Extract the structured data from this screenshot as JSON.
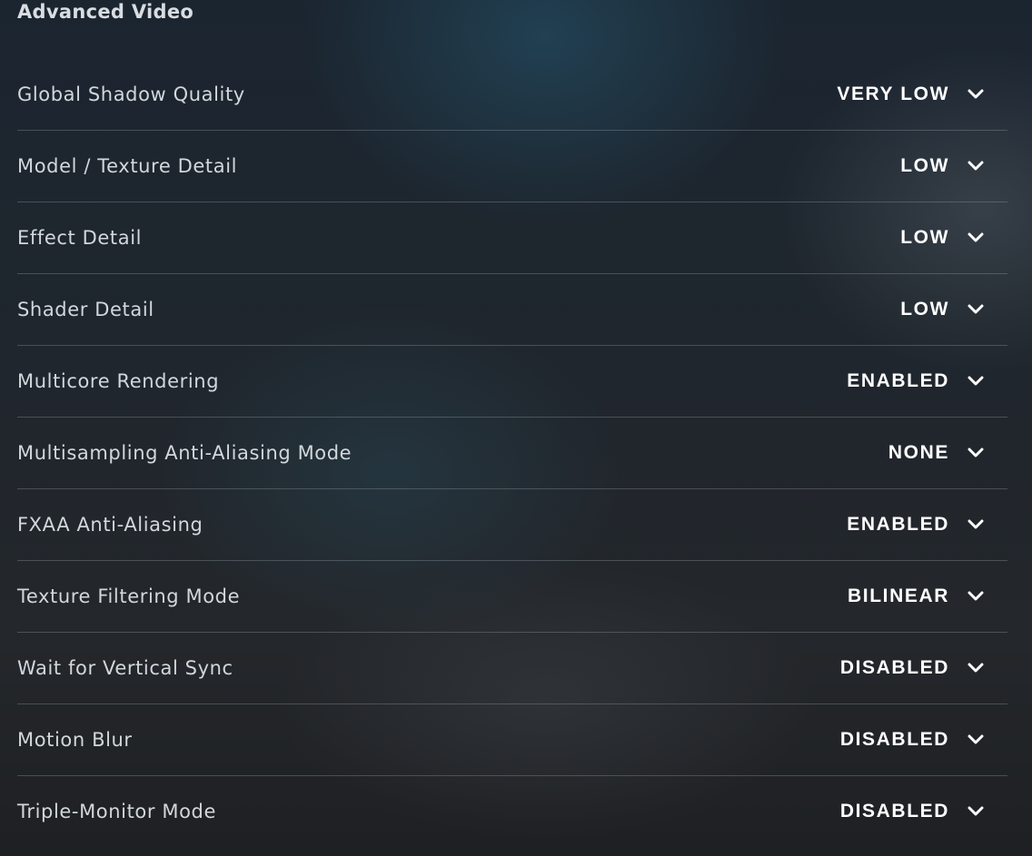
{
  "section": {
    "title": "Advanced Video"
  },
  "settings": [
    {
      "label": "Global Shadow Quality",
      "value": "VERY LOW",
      "icon": "chevron-down-icon"
    },
    {
      "label": "Model / Texture Detail",
      "value": "LOW",
      "icon": "chevron-down-icon"
    },
    {
      "label": "Effect Detail",
      "value": "LOW",
      "icon": "chevron-down-icon"
    },
    {
      "label": "Shader Detail",
      "value": "LOW",
      "icon": "chevron-down-icon"
    },
    {
      "label": "Multicore Rendering",
      "value": "ENABLED",
      "icon": "chevron-down-icon"
    },
    {
      "label": "Multisampling Anti-Aliasing Mode",
      "value": "NONE",
      "icon": "chevron-down-icon"
    },
    {
      "label": "FXAA Anti-Aliasing",
      "value": "ENABLED",
      "icon": "chevron-down-icon"
    },
    {
      "label": "Texture Filtering Mode",
      "value": "BILINEAR",
      "icon": "chevron-down-icon"
    },
    {
      "label": "Wait for Vertical Sync",
      "value": "DISABLED",
      "icon": "chevron-down-icon"
    },
    {
      "label": "Motion Blur",
      "value": "DISABLED",
      "icon": "chevron-down-icon"
    },
    {
      "label": "Triple-Monitor Mode",
      "value": "DISABLED",
      "icon": "chevron-down-icon"
    }
  ],
  "colors": {
    "text": "#d2d7dc",
    "value": "#ffffff",
    "divider": "#5a6068"
  }
}
